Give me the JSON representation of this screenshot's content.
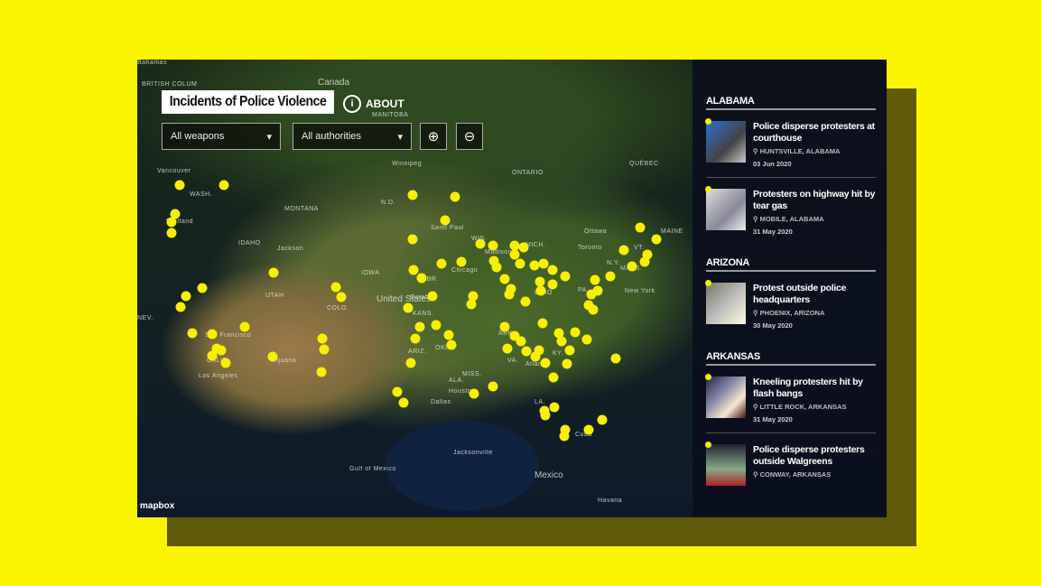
{
  "header": {
    "title": "Incidents of Police Violence",
    "about_label": "ABOUT"
  },
  "filters": {
    "weapons": "All weapons",
    "authorities": "All authorities"
  },
  "attribution": "mapbox",
  "colors": {
    "background": "#fbf500",
    "marker": "#f7f000"
  },
  "map_labels": [
    "Canada",
    "BRITISH COLUM",
    "MANITOBA",
    "ONTARIO",
    "QUÉBEC",
    "Winnipeg",
    "Vancouver",
    "WASH.",
    "MONTANA",
    "N.D.",
    "Saint Paul",
    "Portland",
    "IDAHO",
    "Jackson",
    "WIS.",
    "Madison",
    "MICH.",
    "Ottawa",
    "Toronto",
    "MAINE",
    "VT.",
    "N.Y.",
    "MASS.",
    "New York",
    "PA.",
    "OHIO",
    "Chicago",
    "IOWA",
    "NEBR.",
    "Omaha",
    "United States",
    "KANS.",
    "COLO.",
    "UTAH",
    "NEV.",
    "San Francisco",
    "CALIF.",
    "Los Angeles",
    "Tijuana",
    "ARIZ.",
    "OKLA.",
    "ARK.",
    "KY.",
    "VA.",
    "Atlanta",
    "ALA.",
    "MISS.",
    "Dallas",
    "Houston",
    "LA.",
    "Jacksonville",
    "Gulf of Mexico",
    "Mexico",
    "Havana",
    "Cuba",
    "Bahamas"
  ],
  "sidebar": {
    "groups": [
      {
        "state": "ALABAMA",
        "items": [
          {
            "title": "Police disperse protesters at courthouse",
            "location": "HUNTSVILLE, ALABAMA",
            "date": "03 Jun 2020"
          },
          {
            "title": "Protesters on highway hit by tear gas",
            "location": "MOBILE, ALABAMA",
            "date": "31 May 2020"
          }
        ]
      },
      {
        "state": "ARIZONA",
        "items": [
          {
            "title": "Protest outside police headquarters",
            "location": "PHOENIX, ARIZONA",
            "date": "30 May 2020"
          }
        ]
      },
      {
        "state": "ARKANSAS",
        "items": [
          {
            "title": "Kneeling protesters hit by flash bangs",
            "location": "LITTLE ROCK, ARKANSAS",
            "date": "31 May 2020"
          },
          {
            "title": "Police disperse protesters outside Walgreens",
            "location": "CONWAY, ARKANSAS"
          }
        ]
      }
    ]
  }
}
